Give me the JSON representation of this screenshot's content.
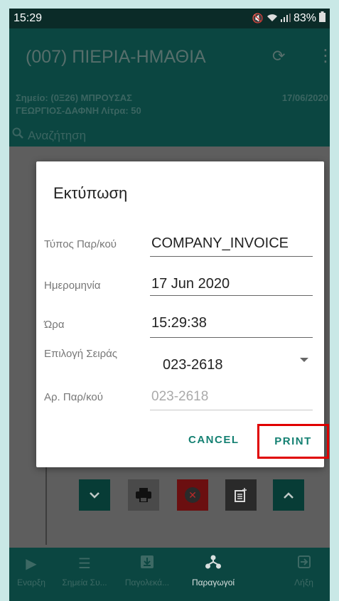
{
  "status_bar": {
    "time": "15:29",
    "battery": "83%",
    "icons": [
      "mute-icon",
      "wifi-icon",
      "signal-icon",
      "battery-icon"
    ]
  },
  "app_bar": {
    "title": "(007) ΠΙΕΡΙΑ-ΗΜΑΘΙΑ",
    "icons": [
      "sync-icon",
      "more-vert-icon"
    ]
  },
  "sub_info": {
    "line1": "Σημείο: (0Ξ26) ΜΠΡΟΥΣΑΣ",
    "line2": "ΓΕΩΡΓΙΟΣ-ΔΑΦΝΗ Λίτρα: 50",
    "date": "17/06/2020"
  },
  "search": {
    "placeholder": "Αναζήτηση"
  },
  "dialog": {
    "title": "Εκτύπωση",
    "fields": [
      {
        "label": "Τύπος Παρ/κού",
        "value": "COMPANY_INVOICE"
      },
      {
        "label": "Ημερομηνία",
        "value": "17 Jun 2020"
      },
      {
        "label": "Ώρα",
        "value": "15:29:38"
      },
      {
        "label": "Επιλογή Σειράς",
        "value": "023-2618"
      },
      {
        "label": "Αρ. Παρ/κού",
        "value": "023-2618"
      }
    ],
    "cancel_label": "CANCEL",
    "print_label": "PRINT",
    "highlight_color": "#e00000",
    "accent_color": "#148072"
  },
  "action_buttons": [
    "chevron-down-icon",
    "print-icon",
    "cancel-circle-icon",
    "note-add-icon",
    "chevron-up-icon"
  ],
  "bottom_nav": {
    "items": [
      {
        "label": "Εναρξη",
        "icon": "play-icon"
      },
      {
        "label": "Σημεία Συ...",
        "icon": "list-icon"
      },
      {
        "label": "Παγολεκά...",
        "icon": "download-box-icon"
      },
      {
        "label": "Παραγωγοί",
        "icon": "hierarchy-icon",
        "active": true
      },
      {
        "label": "Λήξη",
        "icon": "exit-icon"
      }
    ]
  },
  "colors": {
    "app_bar": "#0b4641",
    "status_bar": "#0b2b28"
  }
}
